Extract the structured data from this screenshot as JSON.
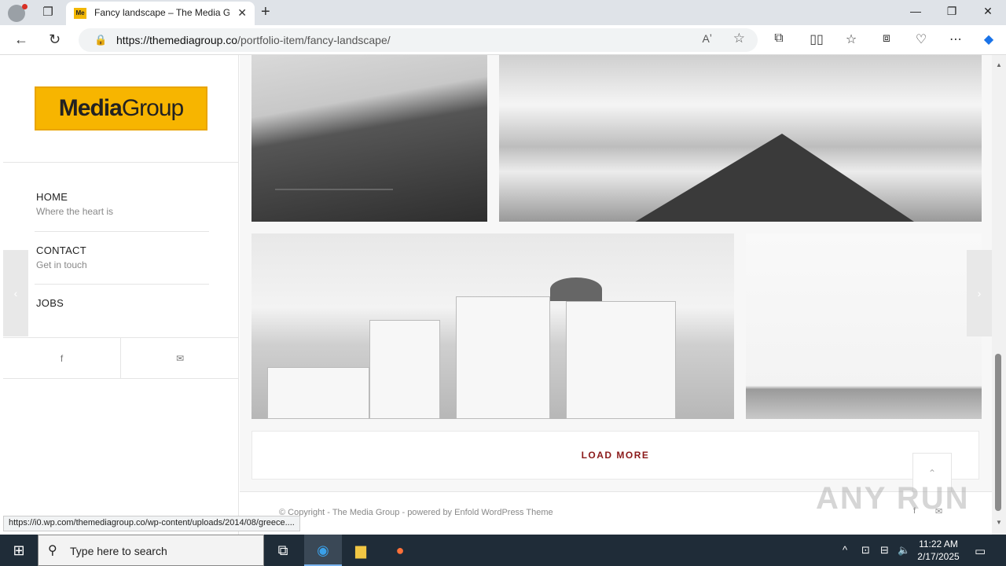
{
  "browser": {
    "tab_title": "Fancy landscape – The Media Gro",
    "favicon_text": "Me",
    "url_host": "https://themediagroup.co",
    "url_path": "/portfolio-item/fancy-landscape/",
    "status_url": "https://i0.wp.com/themediagroup.co/wp-content/uploads/2014/08/greece...."
  },
  "sidebar": {
    "logo_bold": "Media",
    "logo_light": "Group",
    "menu": [
      {
        "label": "HOME",
        "sub": "Where the heart is"
      },
      {
        "label": "CONTACT",
        "sub": "Get in touch"
      },
      {
        "label": "JOBS",
        "sub": ""
      }
    ],
    "social_facebook": "f",
    "social_mail": "✉"
  },
  "main": {
    "load_more": "LOAD MORE"
  },
  "footer": {
    "copyright": "© Copyright - The Media Group - powered by Enfold WordPress Theme",
    "facebook": "f",
    "mail": "✉"
  },
  "watermark": "ANY RUN",
  "taskbar": {
    "search_placeholder": "Type here to search",
    "time": "11:22 AM",
    "date": "2/17/2025"
  }
}
